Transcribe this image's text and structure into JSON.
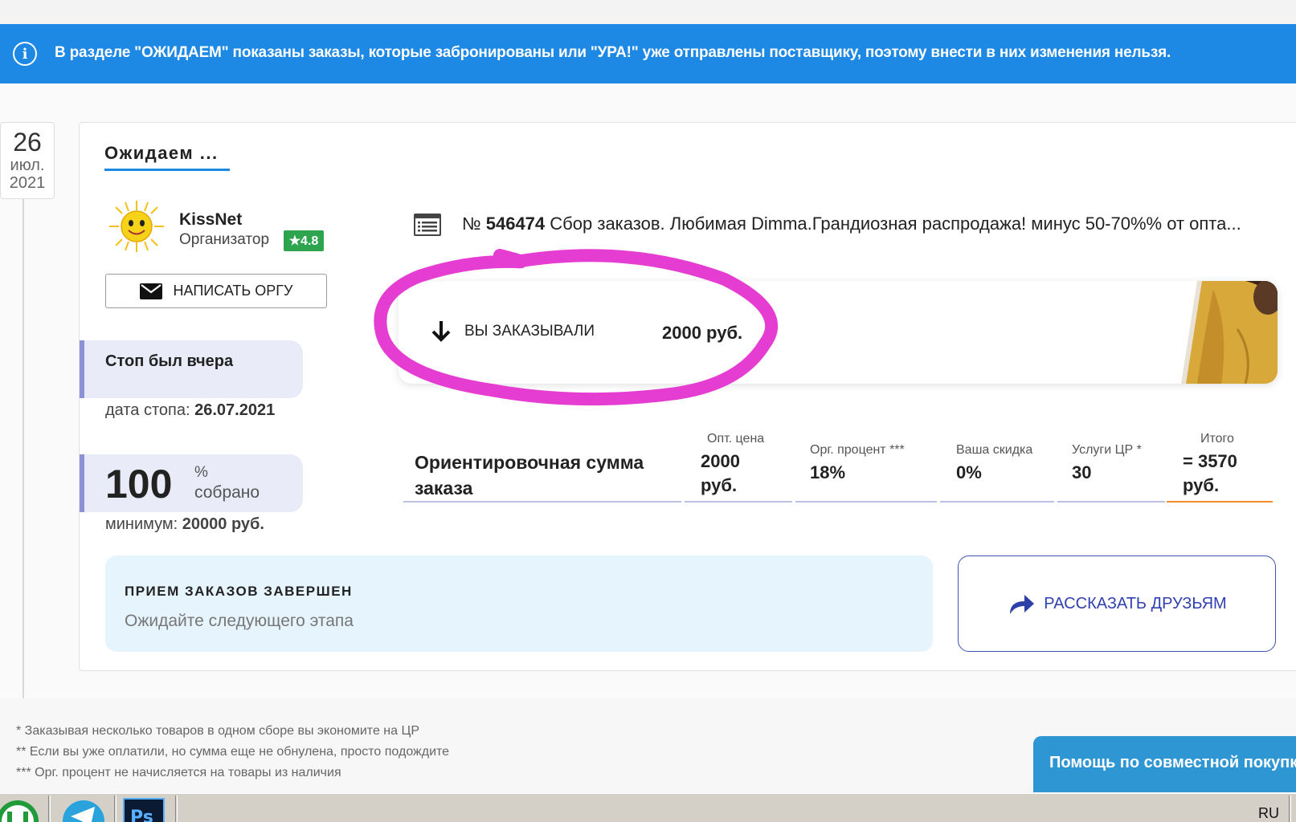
{
  "notice": {
    "text": "В разделе \"ОЖИДАЕМ\" показаны заказы, которые забронированы или \"УРА!\" уже отправлены поставщику, поэтому внести в них изменения нельзя.",
    "color": "#1e88e5"
  },
  "date": {
    "day": "26",
    "month": "июл.",
    "year": "2021"
  },
  "tab": {
    "title": "Ожидаем ..."
  },
  "organizer": {
    "name": "KissNet",
    "role": "Организатор",
    "rating": "★4.8",
    "write_button": "НАПИСАТЬ ОРГУ"
  },
  "stop": {
    "text": "Стоп был вчера",
    "date_label": "дата стопа:",
    "date_value": "26.07.2021"
  },
  "progress": {
    "value": "100",
    "percent_sign": "%",
    "label": "собрано",
    "min_label": "минимум:",
    "min_value": "20000 руб."
  },
  "order": {
    "number_prefix": "№",
    "number": "546474",
    "title": "Сбор заказов. Любимая Dimma.Грандиозная распродажа! минус 50-70%% от опта..."
  },
  "ordered": {
    "label": "ВЫ ЗАКАЗЫВАЛИ",
    "sum": "2000 руб."
  },
  "calc": {
    "title": "Ориентировочная сумма заказа",
    "columns": [
      {
        "head": "Опт. цена",
        "value": "2000 руб."
      },
      {
        "head": "Орг. процент ***",
        "value": "18%"
      },
      {
        "head": "Ваша скидка",
        "value": "0%"
      },
      {
        "head": "Услуги ЦР *",
        "value": "30"
      },
      {
        "head": "Итого",
        "value": "= 3570 руб."
      }
    ]
  },
  "status": {
    "title": "ПРИЕМ ЗАКАЗОВ ЗАВЕРШЕН",
    "subtitle": "Ожидайте следующего этапа"
  },
  "share": {
    "label": "РАССКАЗАТЬ ДРУЗЬЯМ"
  },
  "footnotes": [
    "* Заказывая несколько товаров в одном сборе вы экономите на ЦР",
    "** Если вы уже оплатили, но сумма еще не обнулена, просто подождите",
    "*** Орг. процент не начисляется на товары из наличия"
  ],
  "help": {
    "label": "Помощь по совместной покупке"
  },
  "taskbar": {
    "lang": "RU"
  }
}
